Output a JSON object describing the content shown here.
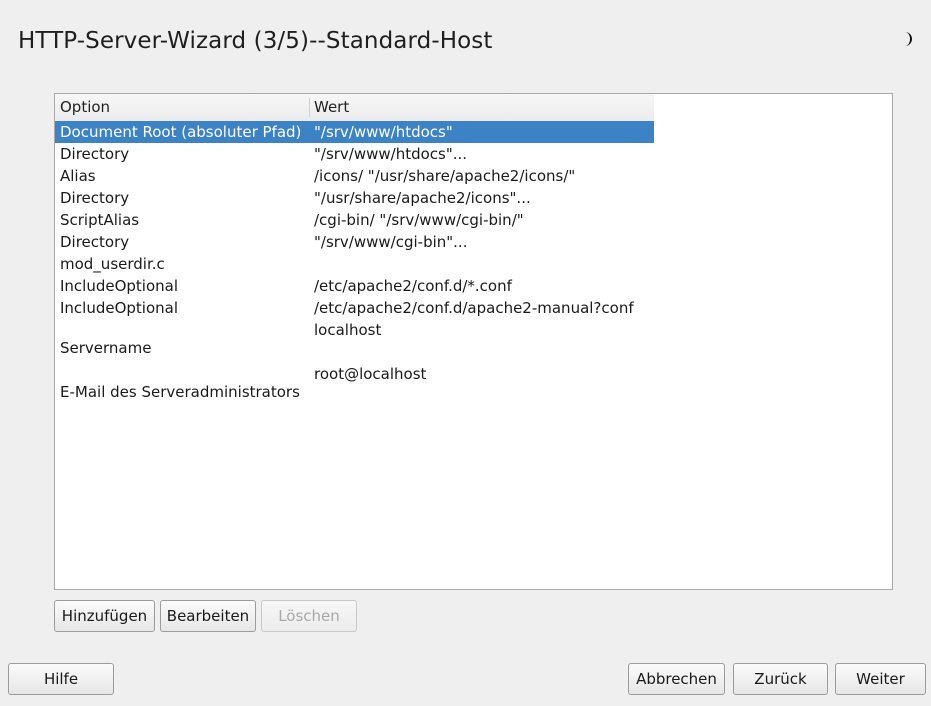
{
  "window": {
    "title": "HTTP-Server-Wizard (3/5)--Standard-Host"
  },
  "table": {
    "headers": {
      "option": "Option",
      "value": "Wert"
    },
    "rows": [
      {
        "option": "Document Root (absoluter Pfad)",
        "value": "\"/srv/www/htdocs\"",
        "selected": true
      },
      {
        "option": "Directory",
        "value": "\"/srv/www/htdocs\"..."
      },
      {
        "option": "Alias",
        "value": "/icons/ \"/usr/share/apache2/icons/\""
      },
      {
        "option": "Directory",
        "value": "\"/usr/share/apache2/icons\"..."
      },
      {
        "option": "ScriptAlias",
        "value": "/cgi-bin/ \"/srv/www/cgi-bin/\""
      },
      {
        "option": "Directory",
        "value": "\"/srv/www/cgi-bin\"..."
      },
      {
        "option": "mod_userdir.c",
        "value": ""
      },
      {
        "option": "IncludeOptional",
        "value": "/etc/apache2/conf.d/*.conf"
      },
      {
        "option": "IncludeOptional",
        "value": "/etc/apache2/conf.d/apache2-manual?conf"
      },
      {
        "option": "Servername",
        "value": "localhost",
        "tall": true
      },
      {
        "option": "E-Mail des Serveradministrators",
        "value": "root@localhost",
        "tall": true
      }
    ]
  },
  "table_buttons": {
    "add": "Hinzufügen",
    "edit": "Bearbeiten",
    "delete": "Löschen"
  },
  "footer_buttons": {
    "help": "Hilfe",
    "abort": "Abbrechen",
    "back": "Zurück",
    "next": "Weiter"
  },
  "icons": {
    "theme": "moon-icon"
  },
  "colors": {
    "selection": "#3c83c6",
    "background": "#efefef"
  }
}
